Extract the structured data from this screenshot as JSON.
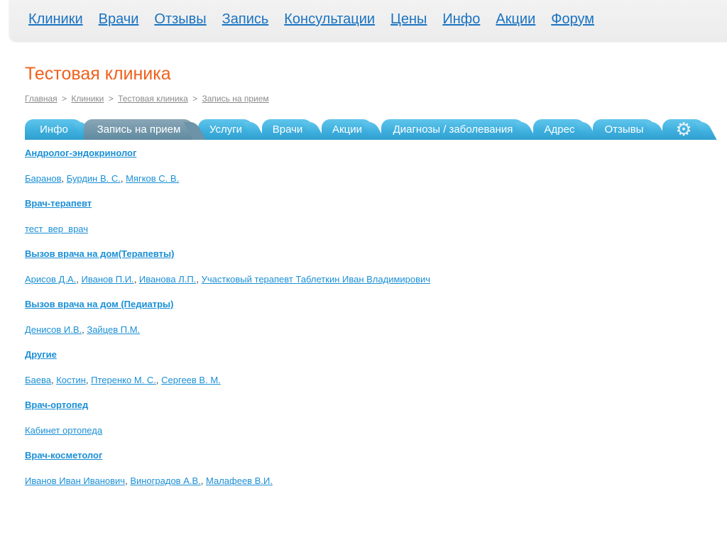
{
  "nav": {
    "items": [
      "Клиники",
      "Врачи",
      "Отзывы",
      "Запись",
      "Консультации",
      "Цены",
      "Инфо",
      "Акции",
      "Форум"
    ]
  },
  "page": {
    "title": "Тестовая клиника"
  },
  "breadcrumb": {
    "items": [
      "Главная",
      "Клиники",
      "Тестовая клиника",
      "Запись на прием"
    ],
    "separator": ">"
  },
  "tabs": {
    "items": [
      "Инфо",
      "Запись на прием",
      "Услуги",
      "Врачи",
      "Акции",
      "Диагнозы / заболевания",
      "Адрес",
      "Отзывы"
    ],
    "active": "Запись на прием",
    "settings_icon": "gear-icon"
  },
  "specialties": [
    {
      "title": "Андролог-эндокринолог",
      "doctors": [
        "Баранов",
        "Бурдин В. С.",
        "Мягков С. В."
      ]
    },
    {
      "title": "Врач-терапевт",
      "doctors": [
        "тест  вер  врач"
      ]
    },
    {
      "title": "Вызов врача на дом(Терапевты)",
      "doctors": [
        "Арисов Д.А.",
        "Иванов П.И.",
        "Иванова Л.П.",
        "Участковый терапевт Таблеткин Иван Владимирович"
      ]
    },
    {
      "title": "Вызов врача на дом (Педиатры)",
      "doctors": [
        "Денисов И.В.",
        "Зайцев П.М."
      ]
    },
    {
      "title": "Другие",
      "doctors": [
        "Баева",
        "Костин",
        "Птеренко М. С.",
        "Сергеев В. М."
      ]
    },
    {
      "title": "Врач-ортопед",
      "doctors": [
        "Кабинет ортопеда"
      ]
    },
    {
      "title": "Врач-косметолог",
      "doctors": [
        "Иванов Иван Иванович",
        "Виноградов А.В.",
        "Малафеев В.И."
      ]
    }
  ],
  "colors": {
    "link": "#1a8fd6",
    "nav_link": "#1a73c2",
    "title": "#f0601c",
    "tab": "#3fb0de",
    "tab_active": "#6c93a7"
  }
}
